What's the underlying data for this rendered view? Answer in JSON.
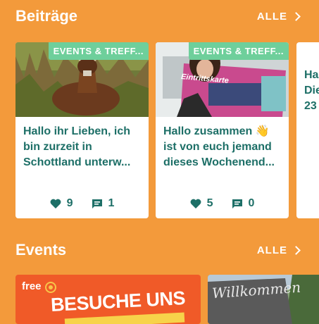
{
  "posts": {
    "title": "Beiträge",
    "all_label": "ALLE",
    "cards": [
      {
        "tag": "EVENTS & TREFF...",
        "text_line1": "Hallo ihr Lieben, ich",
        "text_line2": "bin zurzeit in",
        "text_line3": "Schottland unterw...",
        "likes": "9",
        "comments": "1"
      },
      {
        "tag": "EVENTS & TREFF...",
        "text_line1": "Hallo zusammen 👋",
        "text_line2": "ist von euch jemand",
        "text_line3": "dieses Wochenend...",
        "likes": "5",
        "comments": "0",
        "sign_text": "Eintrittskarte"
      }
    ],
    "partial_card": {
      "line1": "Ha",
      "line2": "Die",
      "line3": "23"
    }
  },
  "events": {
    "title": "Events",
    "all_label": "ALLE",
    "cards": [
      {
        "logo": "free",
        "headline": "BESUCHE UNS"
      },
      {
        "sign_text": "Willkommen"
      }
    ]
  },
  "colors": {
    "background": "#F39A3B",
    "accent_text": "#1D6F67",
    "tag_green": "#6ECF9B"
  }
}
